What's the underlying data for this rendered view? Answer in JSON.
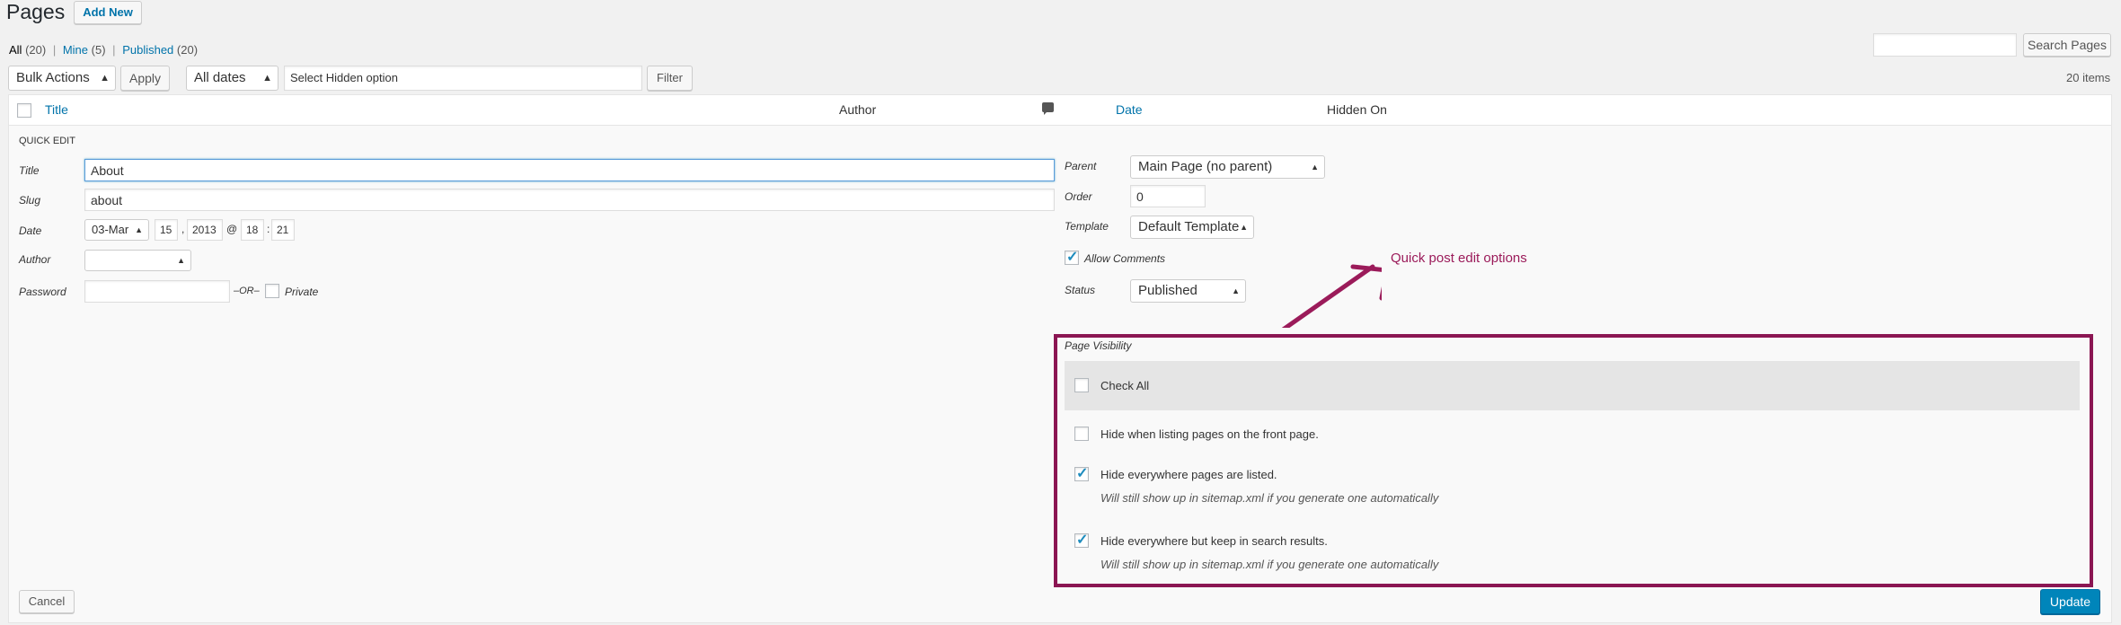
{
  "header": {
    "title": "Pages",
    "add_new": "Add New"
  },
  "filters": {
    "all_label": "All",
    "all_count": "(20)",
    "mine_label": "Mine",
    "mine_count": "(5)",
    "published_label": "Published",
    "published_count": "(20)",
    "separator": "|"
  },
  "search": {
    "value": "",
    "button": "Search Pages"
  },
  "tablenav": {
    "bulk_actions": "Bulk Actions",
    "apply": "Apply",
    "all_dates": "All dates",
    "hidden_option": "Select Hidden option",
    "filter": "Filter",
    "items_count": "20 items"
  },
  "columns": {
    "title": "Title",
    "author": "Author",
    "date": "Date",
    "hidden_on": "Hidden On"
  },
  "quick_edit": {
    "heading": "QUICK EDIT",
    "title_label": "Title",
    "title_value": "About",
    "slug_label": "Slug",
    "slug_value": "about",
    "date_label": "Date",
    "month": "03-Mar",
    "day": "15",
    "comma": ",",
    "year": "2013",
    "at": "@",
    "hour": "18",
    "colon": ":",
    "minute": "21",
    "author_label": "Author",
    "author_value": "",
    "password_label": "Password",
    "password_value": "",
    "or": "–OR–",
    "private_label": "Private",
    "parent_label": "Parent",
    "parent_value": "Main Page (no parent)",
    "order_label": "Order",
    "order_value": "0",
    "template_label": "Template",
    "template_value": "Default Template",
    "allow_comments_label": "Allow Comments",
    "allow_comments_checked": true,
    "status_label": "Status",
    "status_value": "Published",
    "cancel": "Cancel",
    "update": "Update"
  },
  "visibility": {
    "heading": "Page Visibility",
    "check_all": "Check All",
    "options": [
      {
        "label": "Hide when listing pages on the front page.",
        "checked": false,
        "note": ""
      },
      {
        "label": "Hide everywhere pages are listed.",
        "checked": true,
        "note": "Will still show up in sitemap.xml if you generate one automatically"
      },
      {
        "label": "Hide everywhere but keep in search results.",
        "checked": true,
        "note": "Will still show up in sitemap.xml if you generate one automatically"
      }
    ]
  },
  "annotation": {
    "text": "Quick post edit options",
    "color": "#9b1b5a"
  },
  "colors": {
    "link": "#0073aa",
    "primary": "#0085ba",
    "highlight_border": "#8b1653"
  }
}
